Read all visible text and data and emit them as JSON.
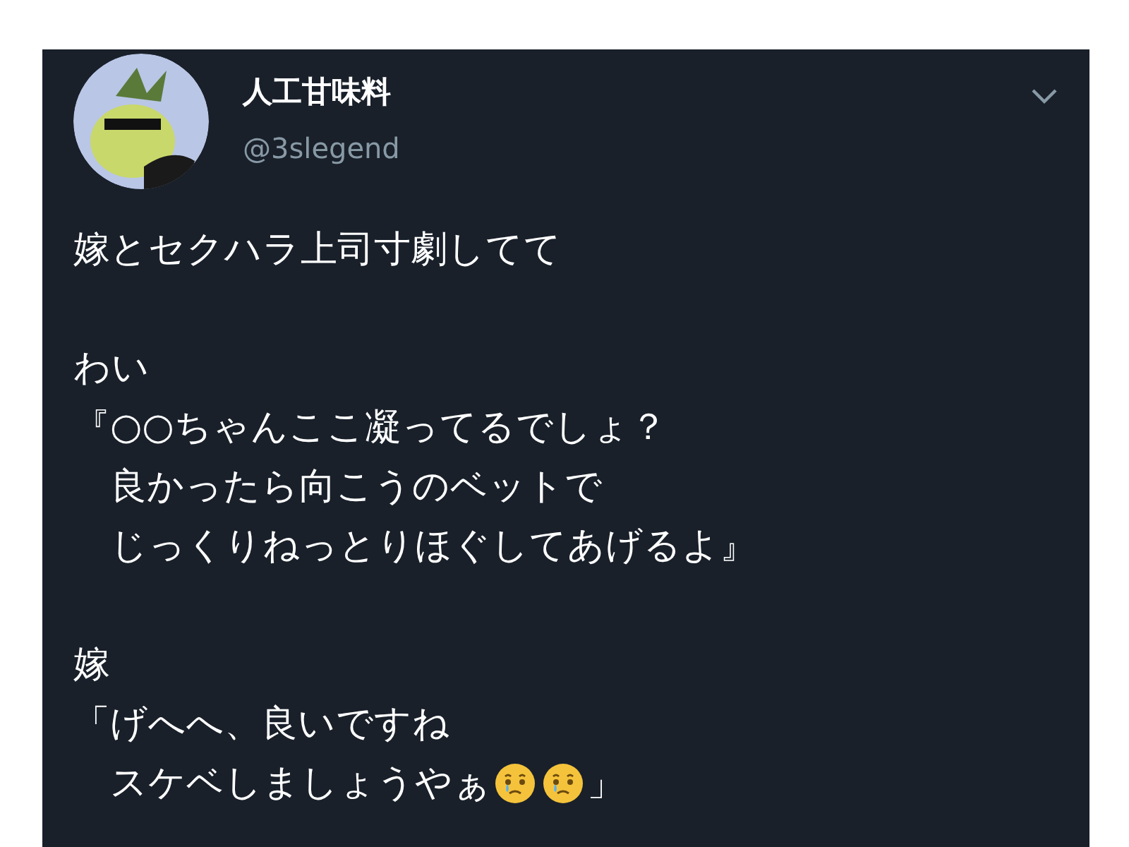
{
  "tweet": {
    "display_name": "人工甘味料",
    "handle": "@3slegend",
    "paragraphs": [
      [
        {
          "parts": [
            {
              "kind": "text",
              "text": "嫁とセクハラ上司寸劇してて"
            }
          ]
        }
      ],
      [
        {
          "parts": [
            {
              "kind": "text",
              "text": "わい"
            }
          ]
        },
        {
          "parts": [
            {
              "kind": "text",
              "text": "『○○ちゃんここ凝ってるでしょ？"
            }
          ]
        },
        {
          "parts": [
            {
              "kind": "text",
              "text": "　良かったら向こうのベットで"
            }
          ]
        },
        {
          "parts": [
            {
              "kind": "text",
              "text": "　じっくりねっとりほぐしてあげるよ』"
            }
          ]
        }
      ],
      [
        {
          "parts": [
            {
              "kind": "text",
              "text": "嫁"
            }
          ]
        },
        {
          "parts": [
            {
              "kind": "text",
              "text": "「げへへ、良いですね"
            }
          ]
        },
        {
          "parts": [
            {
              "kind": "text",
              "text": "　スケベしましょうやぁ"
            },
            {
              "kind": "emoji"
            },
            {
              "kind": "emoji"
            },
            {
              "kind": "text",
              "text": "」"
            }
          ]
        }
      ]
    ]
  }
}
